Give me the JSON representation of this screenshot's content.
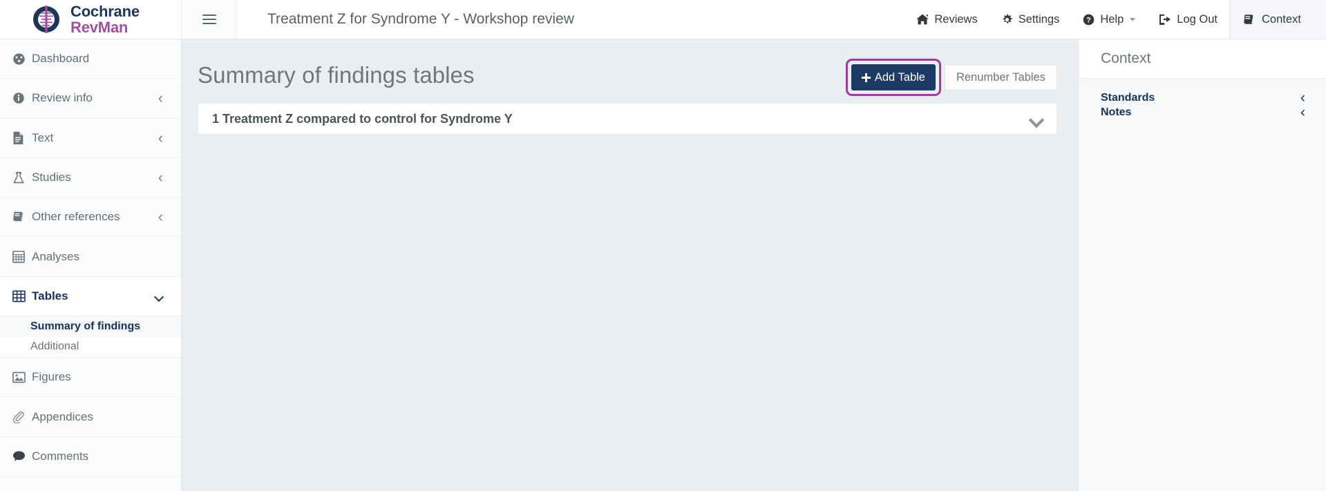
{
  "brand": {
    "line1": "Cochrane",
    "line2": "RevMan",
    "logo_icon": "cochrane-logo-icon",
    "navy": "#1d3557",
    "magenta": "#a0509f"
  },
  "topbar": {
    "menu_icon": "hamburger-menu-icon",
    "review_title": "Treatment Z for Syndrome Y - Workshop review",
    "nav": [
      {
        "label": "Reviews",
        "icon": "home-icon",
        "caret": false
      },
      {
        "label": "Settings",
        "icon": "gear-icon",
        "caret": false
      },
      {
        "label": "Help",
        "icon": "question-circle-icon",
        "caret": true
      },
      {
        "label": "Log Out",
        "icon": "sign-out-icon",
        "caret": false
      },
      {
        "label": "Context",
        "icon": "book-icon",
        "caret": false
      }
    ]
  },
  "sidebar": {
    "items": [
      {
        "label": "Dashboard",
        "icon": "gauge-icon",
        "chevron": "none",
        "active": false
      },
      {
        "label": "Review info",
        "icon": "info-circle-icon",
        "chevron": "left",
        "active": false
      },
      {
        "label": "Text",
        "icon": "document-icon",
        "chevron": "left",
        "active": false
      },
      {
        "label": "Studies",
        "icon": "flask-icon",
        "chevron": "left",
        "active": false
      },
      {
        "label": "Other references",
        "icon": "book-icon",
        "chevron": "left",
        "active": false
      },
      {
        "label": "Analyses",
        "icon": "analyses-grid-icon",
        "chevron": "none",
        "active": false
      },
      {
        "label": "Tables",
        "icon": "table-grid-icon",
        "chevron": "down",
        "active": true
      },
      {
        "label": "Figures",
        "icon": "image-icon",
        "chevron": "none",
        "active": false
      },
      {
        "label": "Appendices",
        "icon": "paperclip-icon",
        "chevron": "none",
        "active": false
      },
      {
        "label": "Comments",
        "icon": "comment-bubble-icon",
        "chevron": "none",
        "active": false
      }
    ],
    "subitems": [
      {
        "label": "Summary of findings",
        "active": true
      },
      {
        "label": "Additional",
        "active": false
      }
    ]
  },
  "main": {
    "page_title": "Summary of findings tables",
    "add_table_label": "Add Table",
    "add_table_icon": "plus-icon",
    "renumber_label": "Renumber Tables",
    "highlight_color": "#9c3f9c",
    "primary_button_color": "#1c3a63",
    "panels": [
      {
        "title": "1 Treatment Z compared to control for Syndrome Y",
        "chevron": "chevron-down-icon"
      }
    ]
  },
  "context": {
    "heading": "Context",
    "rows": [
      {
        "label": "Standards",
        "chevron": "‹"
      },
      {
        "label": "Notes",
        "chevron": "‹"
      }
    ]
  }
}
